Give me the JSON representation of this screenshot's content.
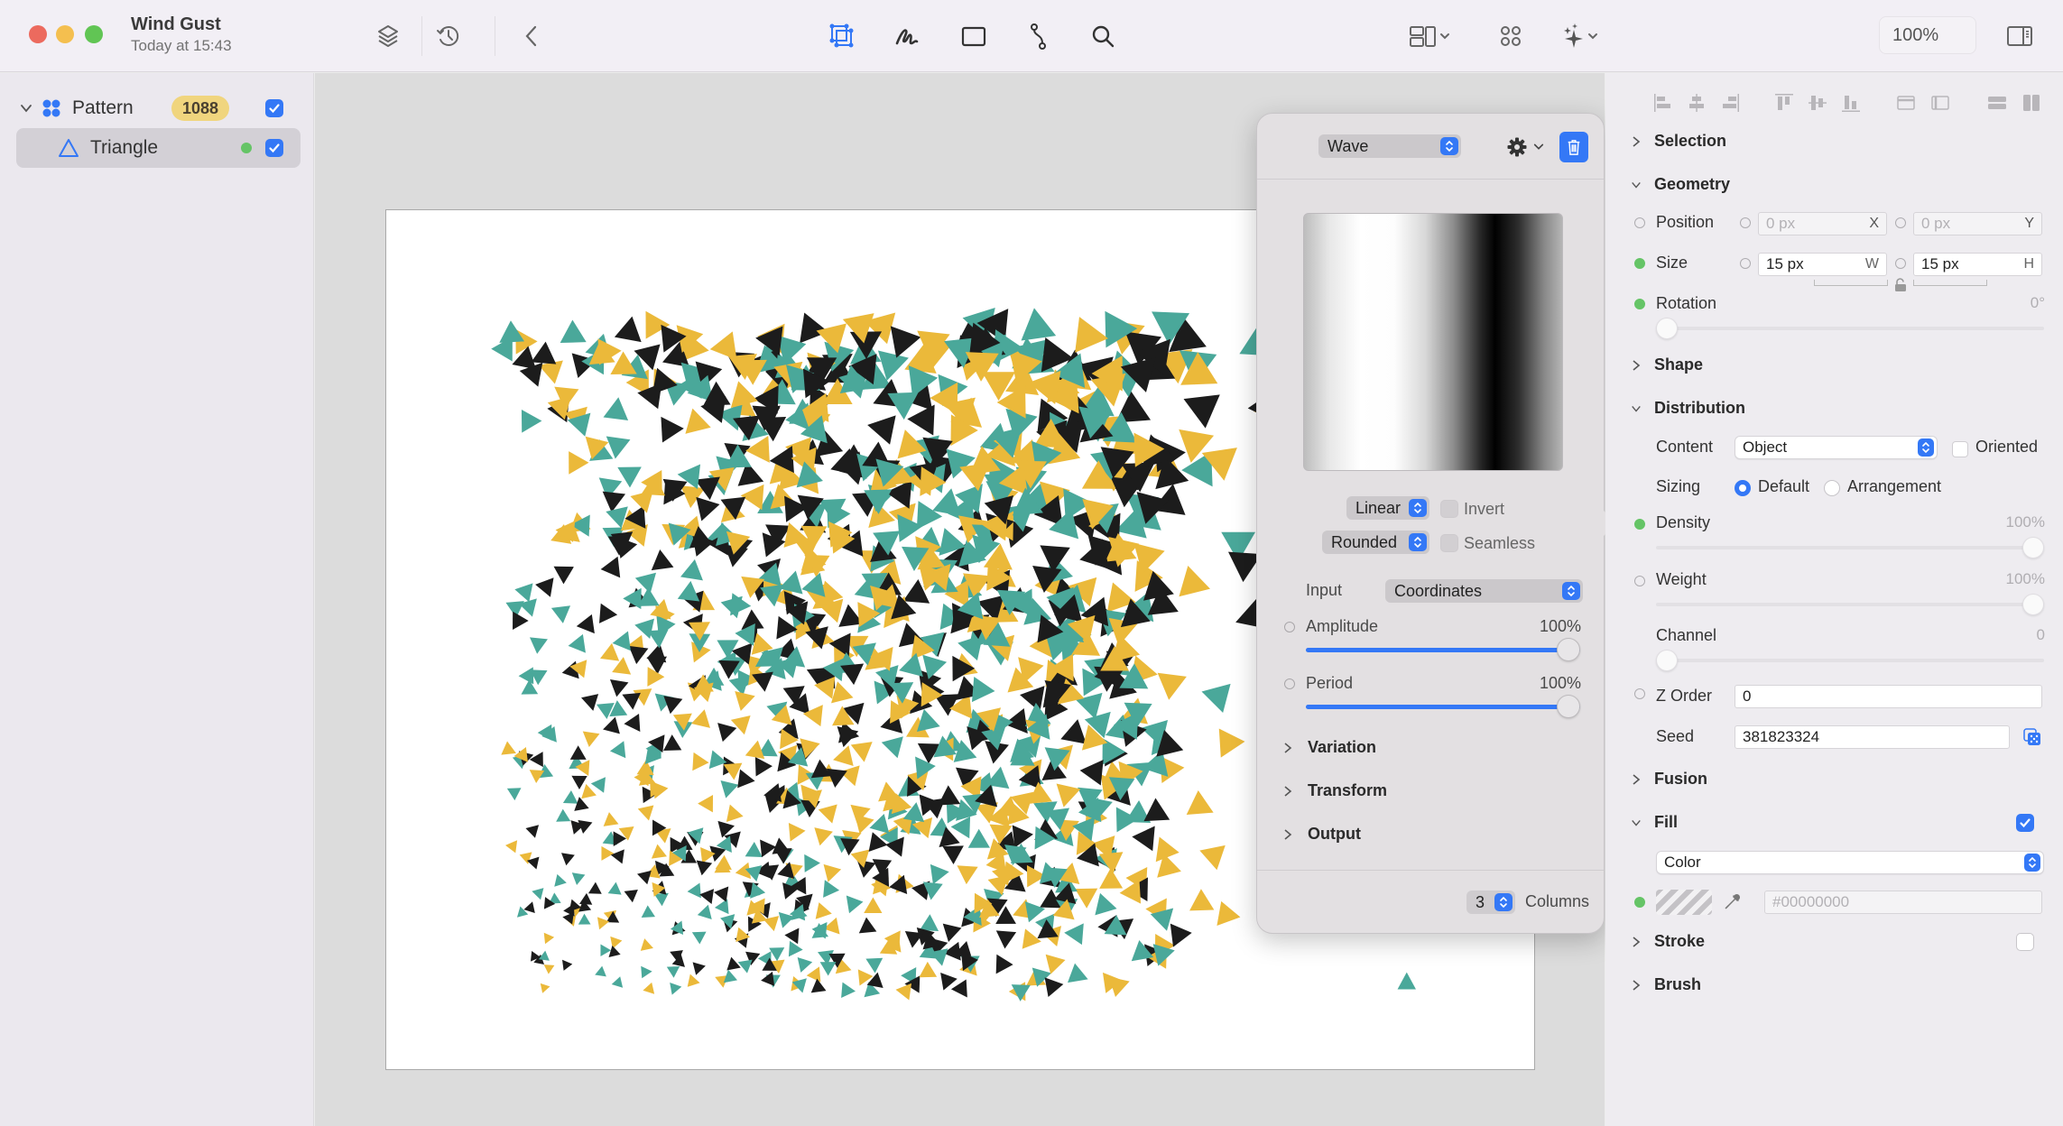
{
  "window": {
    "title": "Wind Gust",
    "subtitle": "Today at 15:43",
    "zoom_level": "100%"
  },
  "toolbar": {
    "left_icons": [
      "layers-icon",
      "history-icon",
      "back-chevron-icon"
    ],
    "center_tools": [
      {
        "name": "transform-tool",
        "active": true
      },
      {
        "name": "brush-tool",
        "active": false
      },
      {
        "name": "rectangle-tool",
        "active": false
      },
      {
        "name": "path-tool",
        "active": false
      },
      {
        "name": "search-tool",
        "active": false
      }
    ],
    "right_icons": [
      "layout-icon",
      "components-icon",
      "magic-sparkle-icon",
      "sidebar-toggle-icon"
    ]
  },
  "layers": [
    {
      "name": "Pattern",
      "count": "1088",
      "visible": true,
      "expanded": true
    },
    {
      "name": "Triangle",
      "visible": true,
      "selected": true,
      "status": "active"
    }
  ],
  "canvas": {
    "pattern": {
      "count": 1088,
      "seed": 381823324,
      "colors": [
        "#4aa89a",
        "#ebb93a",
        "#1c1c1c"
      ]
    }
  },
  "popover": {
    "type_select": "Wave",
    "curve_select": "Linear",
    "invert_label": "Invert",
    "invert_checked": false,
    "shape_select": "Rounded",
    "seamless_label": "Seamless",
    "seamless_checked": false,
    "input_label": "Input",
    "input_select": "Coordinates",
    "amplitude": {
      "label": "Amplitude",
      "value": "100%",
      "fraction": 1.0
    },
    "period": {
      "label": "Period",
      "value": "100%",
      "fraction": 1.0
    },
    "sections": [
      "Variation",
      "Transform",
      "Output"
    ],
    "columns_value": "3",
    "columns_label": "Columns"
  },
  "inspector": {
    "sections": {
      "selection": "Selection",
      "geometry": "Geometry",
      "shape": "Shape",
      "distribution": "Distribution",
      "fusion": "Fusion",
      "fill": "Fill",
      "stroke": "Stroke",
      "brush": "Brush"
    },
    "position": {
      "label": "Position",
      "x": "0 px",
      "x_suffix": "X",
      "y": "0 px",
      "y_suffix": "Y"
    },
    "size": {
      "label": "Size",
      "w": "15 px",
      "w_suffix": "W",
      "h": "15 px",
      "h_suffix": "H"
    },
    "rotation": {
      "label": "Rotation",
      "value": "0°",
      "fraction": 0.0
    },
    "content": {
      "label": "Content",
      "value": "Object",
      "oriented_label": "Oriented",
      "oriented": false
    },
    "sizing": {
      "label": "Sizing",
      "options": [
        "Default",
        "Arrangement"
      ],
      "selected": "Default"
    },
    "density": {
      "label": "Density",
      "value": "100%",
      "fraction": 1.0
    },
    "weight": {
      "label": "Weight",
      "value": "100%",
      "fraction": 1.0
    },
    "channel": {
      "label": "Channel",
      "value": "0",
      "fraction": 0.0
    },
    "z_order": {
      "label": "Z Order",
      "value": "0"
    },
    "seed": {
      "label": "Seed",
      "value": "381823324"
    },
    "fill": {
      "enabled": true,
      "type": "Color",
      "hex": "#00000000"
    },
    "stroke": {
      "enabled": false
    }
  }
}
